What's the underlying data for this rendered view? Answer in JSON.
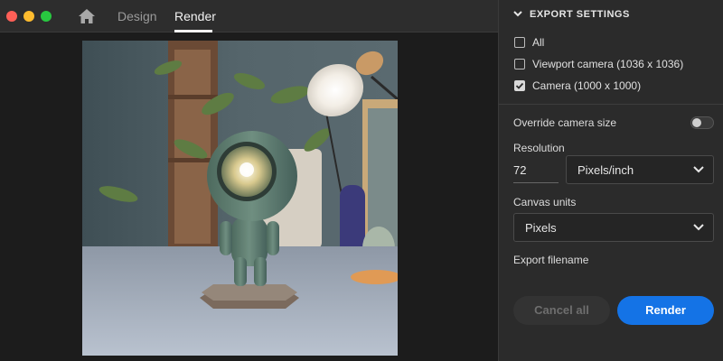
{
  "window": {
    "tabs": [
      "Design",
      "Render"
    ],
    "active_tab": "Render"
  },
  "icons": {
    "home": "home-icon",
    "section_chevron": "chevron-down-icon",
    "dropdown_chevron": "chevron-down-icon"
  },
  "colors": {
    "accent": "#1473e6",
    "close": "#ff5f57",
    "minimize": "#febc2e",
    "maximize": "#28c840"
  },
  "export": {
    "section_title": "EXPORT SETTINGS",
    "options": [
      {
        "label": "All",
        "checked": false
      },
      {
        "label": "Viewport camera (1036 x 1036)",
        "checked": false
      },
      {
        "label": "Camera (1000 x 1000)",
        "checked": true
      }
    ],
    "override_label": "Override camera size",
    "override_on": false,
    "resolution_label": "Resolution",
    "resolution_value": "72",
    "resolution_unit": "Pixels/inch",
    "canvas_units_label": "Canvas units",
    "canvas_units_value": "Pixels",
    "filename_label": "Export filename",
    "cancel_label": "Cancel all",
    "render_label": "Render"
  }
}
